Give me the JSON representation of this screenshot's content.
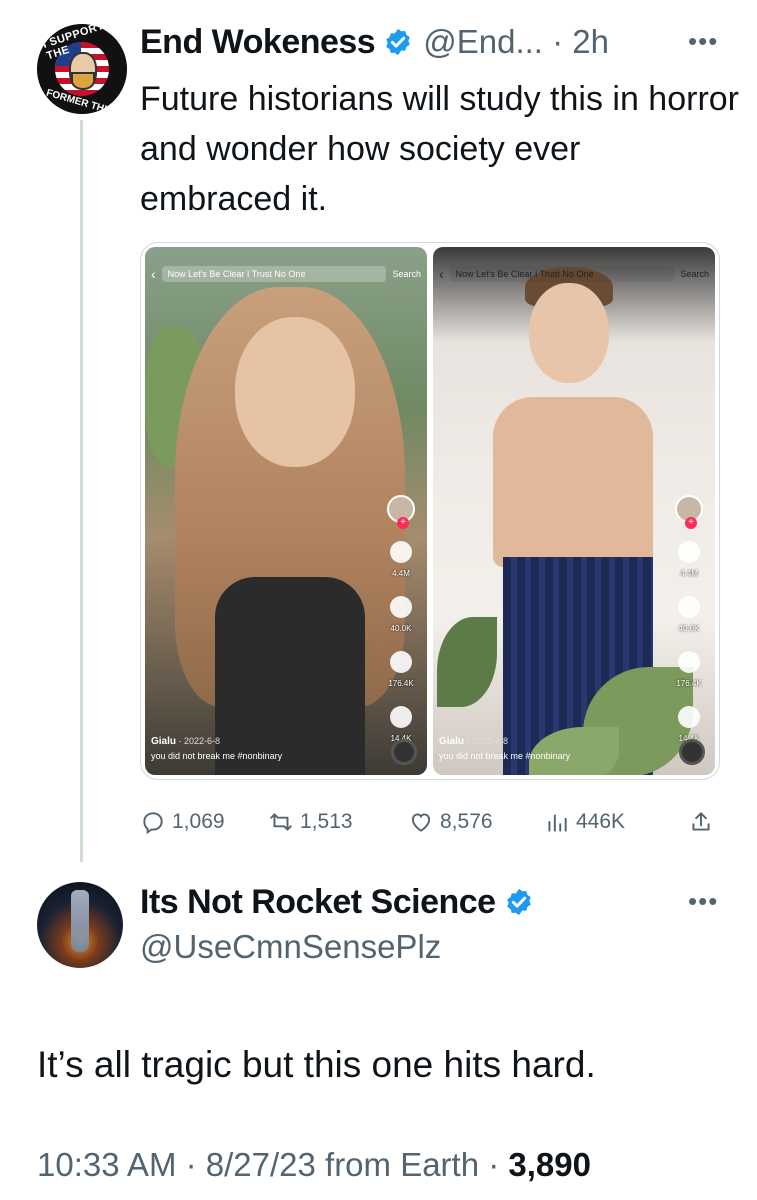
{
  "tweet1": {
    "avatar_text_top": "I SUPPORT THE",
    "avatar_text_bottom": "FORMER THING",
    "display_name": "End Wokeness",
    "handle_time": "@End... · 2h",
    "more_icon": "more-horizontal-icon",
    "text": "Future historians will study this in horror and wonder how society ever embraced it.",
    "media": {
      "left": {
        "search": "Now Let's Be Clear I Trust No One",
        "search_button": "Search",
        "counts": [
          "4.4M",
          "40.0K",
          "176.4K",
          "14.4K"
        ],
        "user": "Gialu",
        "date": "2022-6-8",
        "caption": "you did not break me #nonbinary"
      },
      "right": {
        "search": "Now Let's Be Clear I Trust No One",
        "search_button": "Search",
        "counts": [
          "4.4M",
          "40.0K",
          "176.4K",
          "14.4K"
        ],
        "user": "Gialu",
        "date": "2022-6-8",
        "caption": "you did not break me #nonbinary"
      }
    },
    "actions": {
      "replies": "1,069",
      "retweets": "1,513",
      "likes": "8,576",
      "views": "446K"
    },
    "accent_color": "#1d9bf0"
  },
  "tweet2": {
    "display_name": "Its Not Rocket Science",
    "handle": "@UseCmnSensePlz",
    "more_icon": "more-horizontal-icon",
    "text": "It’s all tragic but this one hits hard.",
    "meta": "10:33 AM · 8/27/23 from Earth · ",
    "views": "3,890"
  }
}
